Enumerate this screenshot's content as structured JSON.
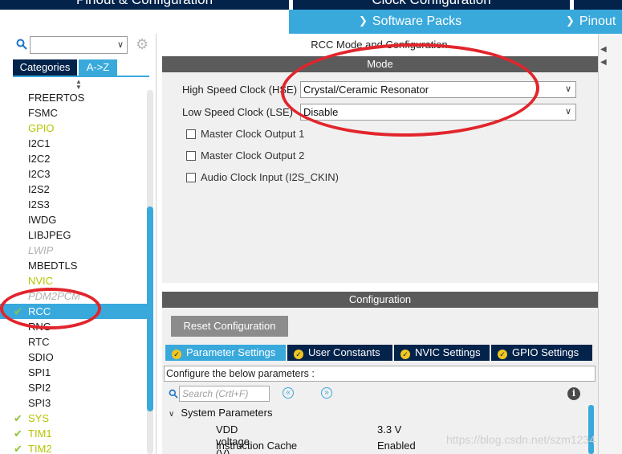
{
  "top_tabs": [
    "Pinout & Configuration",
    "Clock Configuration"
  ],
  "toolbar": {
    "software_packs": "Software Packs",
    "pinout": "Pinout"
  },
  "left": {
    "search_placeholder": "",
    "cat_tabs": [
      "Categories",
      "A->Z"
    ],
    "peripherals": [
      {
        "label": "FREERTOS",
        "state": "normal"
      },
      {
        "label": "FSMC",
        "state": "normal"
      },
      {
        "label": "GPIO",
        "state": "warn"
      },
      {
        "label": "I2C1",
        "state": "normal"
      },
      {
        "label": "I2C2",
        "state": "normal"
      },
      {
        "label": "I2C3",
        "state": "normal"
      },
      {
        "label": "I2S2",
        "state": "normal"
      },
      {
        "label": "I2S3",
        "state": "normal"
      },
      {
        "label": "IWDG",
        "state": "normal"
      },
      {
        "label": "LIBJPEG",
        "state": "normal"
      },
      {
        "label": "LWIP",
        "state": "disabled"
      },
      {
        "label": "MBEDTLS",
        "state": "normal"
      },
      {
        "label": "NVIC",
        "state": "warn"
      },
      {
        "label": "PDM2PCM",
        "state": "disabled"
      },
      {
        "label": "RCC",
        "state": "selected",
        "check": true
      },
      {
        "label": "RNG",
        "state": "normal"
      },
      {
        "label": "RTC",
        "state": "normal"
      },
      {
        "label": "SDIO",
        "state": "normal"
      },
      {
        "label": "SPI1",
        "state": "normal"
      },
      {
        "label": "SPI2",
        "state": "normal"
      },
      {
        "label": "SPI3",
        "state": "normal"
      },
      {
        "label": "SYS",
        "state": "warn",
        "check": true
      },
      {
        "label": "TIM1",
        "state": "warn",
        "check": true
      },
      {
        "label": "TIM2",
        "state": "warn",
        "check": true
      }
    ]
  },
  "rcc": {
    "title": "RCC Mode and Configuration",
    "mode_header": "Mode",
    "hse_label": "High Speed Clock (HSE)",
    "hse_value": "Crystal/Ceramic Resonator",
    "lse_label": "Low Speed Clock (LSE)",
    "lse_value": "Disable",
    "checkboxes": [
      "Master Clock Output 1",
      "Master Clock Output 2",
      "Audio Clock Input (I2S_CKIN)"
    ]
  },
  "config": {
    "header": "Configuration",
    "reset_label": "Reset Configuration",
    "tabs": [
      "Parameter Settings",
      "User Constants",
      "NVIC Settings",
      "GPIO Settings"
    ],
    "subtitle": "Configure the below parameters :",
    "search_placeholder": "Search (Crtl+F)",
    "group": "System Parameters",
    "params": [
      {
        "name": "VDD voltage (V)",
        "value": "3.3 V"
      },
      {
        "name": "Instruction Cache",
        "value": "Enabled"
      }
    ]
  },
  "watermark": "https://blog.csdn.net/szm1234",
  "colors": {
    "accent": "#39a9dc",
    "navy": "#03234b",
    "ok_check": "#8cc63f",
    "warn_text": "#b7c400",
    "annotation": "#e2252b"
  }
}
